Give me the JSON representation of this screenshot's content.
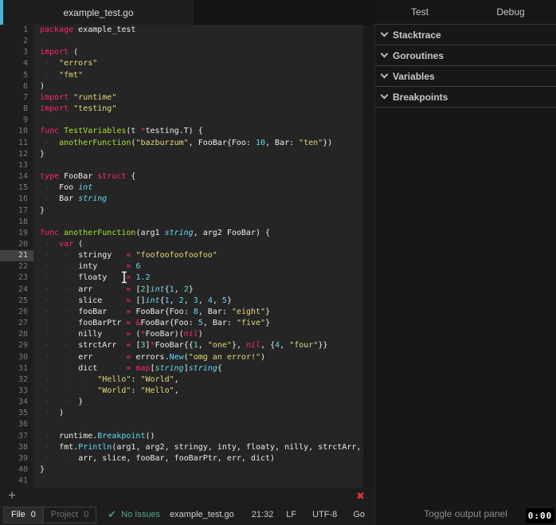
{
  "colors": {
    "accent_stripe": "#4db5dc",
    "keyword": "#f92672",
    "string": "#e6db74",
    "number": "#66d9ef",
    "function": "#a6e22e",
    "close_red": "#d23535",
    "ok_green": "#52a884"
  },
  "tabs": {
    "file": "example_test.go",
    "right": [
      "Test",
      "Debug"
    ]
  },
  "panel": {
    "sections": [
      "Stacktrace",
      "Goroutines",
      "Variables",
      "Breakpoints"
    ],
    "toggle_label": "Toggle output panel"
  },
  "statusbar": {
    "file_label": "File",
    "file_count": "0",
    "project_label": "Project",
    "project_count": "0",
    "check_icon": "✔",
    "check_label": "No Issues",
    "filename": "example_test.go",
    "cursor": "21:32",
    "right_items": [
      "LF",
      "UTF-8",
      "Go"
    ],
    "plus_icon": "+",
    "close_icon": "✖"
  },
  "timer": "0:00",
  "editor": {
    "current_line": 21,
    "lines": [
      {
        "t": [
          [
            "k",
            "package"
          ],
          [
            "p",
            " example_test"
          ]
        ]
      },
      {
        "t": []
      },
      {
        "t": [
          [
            "k",
            "import"
          ],
          [
            "p",
            " ("
          ]
        ]
      },
      {
        "t": [
          [
            "d",
            " ·  "
          ],
          [
            "s",
            "\"errors\""
          ]
        ]
      },
      {
        "t": [
          [
            "d",
            " ·  "
          ],
          [
            "s",
            "\"fmt\""
          ]
        ]
      },
      {
        "t": [
          [
            "p",
            ")"
          ]
        ]
      },
      {
        "t": [
          [
            "k",
            "import"
          ],
          [
            "p",
            " "
          ],
          [
            "s",
            "\"runtime\""
          ]
        ]
      },
      {
        "t": [
          [
            "k",
            "import"
          ],
          [
            "p",
            " "
          ],
          [
            "s",
            "\"testing\""
          ]
        ]
      },
      {
        "t": []
      },
      {
        "t": [
          [
            "k",
            "func"
          ],
          [
            "p",
            " "
          ],
          [
            "f",
            "TestVariables"
          ],
          [
            "p",
            "(t "
          ],
          [
            "k",
            "*"
          ],
          [
            "p",
            "testing.T) {"
          ]
        ]
      },
      {
        "t": [
          [
            "d",
            " ·  "
          ],
          [
            "f",
            "anotherFunction"
          ],
          [
            "p",
            "("
          ],
          [
            "s",
            "\"bazburzum\""
          ],
          [
            "p",
            ", FooBar{Foo: "
          ],
          [
            "n",
            "10"
          ],
          [
            "p",
            ", Bar: "
          ],
          [
            "s",
            "\"ten\""
          ],
          [
            "p",
            "})"
          ]
        ]
      },
      {
        "t": [
          [
            "p",
            "}"
          ]
        ]
      },
      {
        "t": []
      },
      {
        "t": [
          [
            "k",
            "type"
          ],
          [
            "p",
            " FooBar "
          ],
          [
            "k",
            "struct"
          ],
          [
            "p",
            " {"
          ]
        ]
      },
      {
        "t": [
          [
            "d",
            " ·  "
          ],
          [
            "p",
            "Foo "
          ],
          [
            "y",
            "int"
          ]
        ]
      },
      {
        "t": [
          [
            "d",
            " ·  "
          ],
          [
            "p",
            "Bar "
          ],
          [
            "y",
            "string"
          ]
        ]
      },
      {
        "t": [
          [
            "p",
            "}"
          ]
        ]
      },
      {
        "t": []
      },
      {
        "t": [
          [
            "k",
            "func"
          ],
          [
            "p",
            " "
          ],
          [
            "f",
            "anotherFunction"
          ],
          [
            "p",
            "(arg1 "
          ],
          [
            "y",
            "string"
          ],
          [
            "p",
            ", arg2 FooBar) {"
          ]
        ]
      },
      {
        "t": [
          [
            "d",
            " ·  "
          ],
          [
            "k",
            "var"
          ],
          [
            "p",
            " ("
          ]
        ]
      },
      {
        "t": [
          [
            "d",
            " ·  "
          ],
          [
            "d",
            " ·  "
          ],
          [
            "p",
            "stringy   "
          ],
          [
            "k",
            "="
          ],
          [
            "p",
            " "
          ],
          [
            "s",
            "\"foofoofoofoofoo\""
          ]
        ]
      },
      {
        "t": [
          [
            "d",
            " ·  "
          ],
          [
            "d",
            " ·  "
          ],
          [
            "p",
            "inty      "
          ],
          [
            "k",
            "="
          ],
          [
            "p",
            " "
          ],
          [
            "n",
            "6"
          ]
        ]
      },
      {
        "t": [
          [
            "d",
            " ·  "
          ],
          [
            "d",
            " ·  "
          ],
          [
            "p",
            "floaty    "
          ],
          [
            "k",
            "="
          ],
          [
            "p",
            " "
          ],
          [
            "n",
            "1.2"
          ]
        ]
      },
      {
        "t": [
          [
            "d",
            " ·  "
          ],
          [
            "d",
            " ·  "
          ],
          [
            "p",
            "arr       "
          ],
          [
            "k",
            "="
          ],
          [
            "p",
            " ["
          ],
          [
            "n",
            "2"
          ],
          [
            "p",
            "]"
          ],
          [
            "y",
            "int"
          ],
          [
            "p",
            "{"
          ],
          [
            "n",
            "1"
          ],
          [
            "p",
            ", "
          ],
          [
            "n",
            "2"
          ],
          [
            "p",
            "}"
          ]
        ]
      },
      {
        "t": [
          [
            "d",
            " ·  "
          ],
          [
            "d",
            " ·  "
          ],
          [
            "p",
            "slice     "
          ],
          [
            "k",
            "="
          ],
          [
            "p",
            " []"
          ],
          [
            "y",
            "int"
          ],
          [
            "p",
            "{"
          ],
          [
            "n",
            "1"
          ],
          [
            "p",
            ", "
          ],
          [
            "n",
            "2"
          ],
          [
            "p",
            ", "
          ],
          [
            "n",
            "3"
          ],
          [
            "p",
            ", "
          ],
          [
            "n",
            "4"
          ],
          [
            "p",
            ", "
          ],
          [
            "n",
            "5"
          ],
          [
            "p",
            "}"
          ]
        ]
      },
      {
        "t": [
          [
            "d",
            " ·  "
          ],
          [
            "d",
            " ·  "
          ],
          [
            "p",
            "fooBar    "
          ],
          [
            "k",
            "="
          ],
          [
            "p",
            " FooBar{Foo: "
          ],
          [
            "n",
            "8"
          ],
          [
            "p",
            ", Bar: "
          ],
          [
            "s",
            "\"eight\""
          ],
          [
            "p",
            "}"
          ]
        ]
      },
      {
        "t": [
          [
            "d",
            " ·  "
          ],
          [
            "d",
            " ·  "
          ],
          [
            "p",
            "fooBarPtr "
          ],
          [
            "k",
            "="
          ],
          [
            "p",
            " "
          ],
          [
            "k",
            "&"
          ],
          [
            "p",
            "FooBar{Foo: "
          ],
          [
            "n",
            "5"
          ],
          [
            "p",
            ", Bar: "
          ],
          [
            "s",
            "\"five\""
          ],
          [
            "p",
            "}"
          ]
        ]
      },
      {
        "t": [
          [
            "d",
            " ·  "
          ],
          [
            "d",
            " ·  "
          ],
          [
            "p",
            "nilly     "
          ],
          [
            "k",
            "="
          ],
          [
            "p",
            " ("
          ],
          [
            "k",
            "*"
          ],
          [
            "p",
            "FooBar)("
          ],
          [
            "i",
            "nil"
          ],
          [
            "p",
            ")"
          ]
        ]
      },
      {
        "t": [
          [
            "d",
            " ·  "
          ],
          [
            "d",
            " ·  "
          ],
          [
            "p",
            "strctArr  "
          ],
          [
            "k",
            "="
          ],
          [
            "p",
            " ["
          ],
          [
            "n",
            "3"
          ],
          [
            "p",
            "]"
          ],
          [
            "k",
            "*"
          ],
          [
            "p",
            "FooBar{{"
          ],
          [
            "n",
            "1"
          ],
          [
            "p",
            ", "
          ],
          [
            "s",
            "\"one\""
          ],
          [
            "p",
            "}, "
          ],
          [
            "i",
            "nil"
          ],
          [
            "p",
            ", {"
          ],
          [
            "n",
            "4"
          ],
          [
            "p",
            ", "
          ],
          [
            "s",
            "\"four\""
          ],
          [
            "p",
            "}}"
          ]
        ]
      },
      {
        "t": [
          [
            "d",
            " ·  "
          ],
          [
            "d",
            " ·  "
          ],
          [
            "p",
            "err       "
          ],
          [
            "k",
            "="
          ],
          [
            "p",
            " errors."
          ],
          [
            "m",
            "New"
          ],
          [
            "p",
            "("
          ],
          [
            "s",
            "\"omg an error!\""
          ],
          [
            "p",
            ")"
          ]
        ]
      },
      {
        "t": [
          [
            "d",
            " ·  "
          ],
          [
            "d",
            " ·  "
          ],
          [
            "p",
            "dict      "
          ],
          [
            "k",
            "="
          ],
          [
            "p",
            " "
          ],
          [
            "k",
            "map"
          ],
          [
            "p",
            "["
          ],
          [
            "y",
            "string"
          ],
          [
            "p",
            "]"
          ],
          [
            "y",
            "string"
          ],
          [
            "p",
            "{"
          ]
        ]
      },
      {
        "t": [
          [
            "d",
            " ·  "
          ],
          [
            "d",
            " ·  "
          ],
          [
            "d",
            " ·  "
          ],
          [
            "s",
            "\"Hello\""
          ],
          [
            "p",
            ": "
          ],
          [
            "s",
            "\"World\""
          ],
          [
            "p",
            ","
          ]
        ]
      },
      {
        "t": [
          [
            "d",
            " ·  "
          ],
          [
            "d",
            " ·  "
          ],
          [
            "d",
            " ·  "
          ],
          [
            "s",
            "\"World\""
          ],
          [
            "p",
            ": "
          ],
          [
            "s",
            "\"Hello\""
          ],
          [
            "p",
            ","
          ]
        ]
      },
      {
        "t": [
          [
            "d",
            " ·  "
          ],
          [
            "d",
            " ·  "
          ],
          [
            "p",
            "}"
          ]
        ]
      },
      {
        "t": [
          [
            "d",
            " ·  "
          ],
          [
            "p",
            ")"
          ]
        ]
      },
      {
        "t": []
      },
      {
        "t": [
          [
            "d",
            " ·  "
          ],
          [
            "p",
            "runtime."
          ],
          [
            "m",
            "Breakpoint"
          ],
          [
            "p",
            "()"
          ]
        ]
      },
      {
        "t": [
          [
            "d",
            " ·  "
          ],
          [
            "p",
            "fmt."
          ],
          [
            "m",
            "Println"
          ],
          [
            "p",
            "(arg1, arg2, stringy, inty, floaty, nilly, strctArr,"
          ]
        ]
      },
      {
        "t": [
          [
            "d",
            " ·  "
          ],
          [
            "d",
            " ·  "
          ],
          [
            "p",
            "arr, slice, fooBar, fooBarPtr, err, dict)"
          ]
        ]
      },
      {
        "t": [
          [
            "p",
            "}"
          ]
        ]
      },
      {
        "t": []
      }
    ]
  }
}
